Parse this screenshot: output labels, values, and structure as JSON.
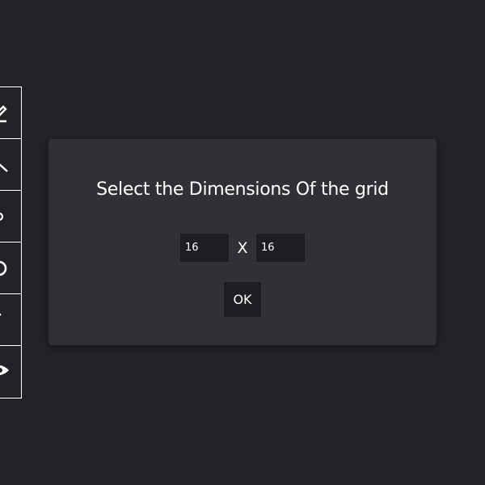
{
  "toolbar": {
    "items": [
      {
        "icon": "pencil-icon"
      },
      {
        "icon": "line-icon"
      },
      {
        "icon": "fill-icon"
      },
      {
        "icon": "circle-icon"
      },
      {
        "icon": "picker-icon"
      },
      {
        "icon": "eye-icon"
      }
    ]
  },
  "dialog": {
    "title": "Select the Dimensions Of the grid",
    "width_value": "16",
    "separator": "X",
    "height_value": "16",
    "ok_label": "OK"
  },
  "colors": {
    "background": "#232227",
    "dialog_background": "#333035",
    "input_background": "#1e1d21",
    "text": "#ffffff"
  }
}
